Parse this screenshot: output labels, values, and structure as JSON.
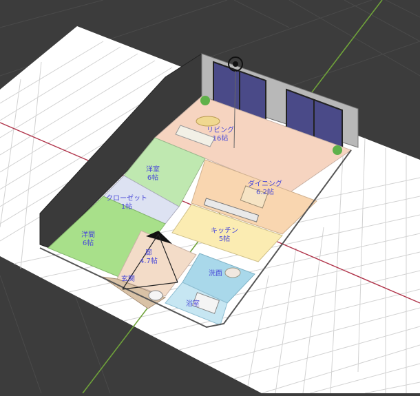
{
  "viewport": {
    "background": "#3c3c3c",
    "grid_color": "#cfcfcf",
    "floor_color": "#ffffff",
    "x_axis_color": "#b0344a",
    "y_axis_color": "#6fa23a"
  },
  "floorplan": {
    "rooms": [
      {
        "id": "living",
        "label": "リビング",
        "size": "16帖",
        "color": "#f6d4c0"
      },
      {
        "id": "western-1",
        "label": "洋室",
        "size": "6帖",
        "color": "#bfe8b0"
      },
      {
        "id": "dining",
        "label": "ダイニング",
        "size": "6.2帖",
        "color": "#f9d6b0"
      },
      {
        "id": "closet",
        "label": "クローゼット",
        "size": "1帖",
        "color": "#dde2f2"
      },
      {
        "id": "western-2",
        "label": "洋間",
        "size": "6帖",
        "color": "#a8e08a"
      },
      {
        "id": "kitchen",
        "label": "キッチン",
        "size": "5帖",
        "color": "#fbecb2"
      },
      {
        "id": "hall",
        "label": "廊",
        "size": "4.7帖",
        "color": "#f3dcc8"
      },
      {
        "id": "entrance",
        "label": "玄関",
        "size": "",
        "color": "#d9c2a6"
      },
      {
        "id": "washroom",
        "label": "洗面",
        "size": "",
        "color": "#a9d8ea"
      },
      {
        "id": "bath",
        "label": "浴室",
        "size": "",
        "color": "#c6e6f2"
      }
    ]
  },
  "icons": {
    "camera": "camera-target-icon",
    "viewer": "viewer-cone-icon"
  }
}
